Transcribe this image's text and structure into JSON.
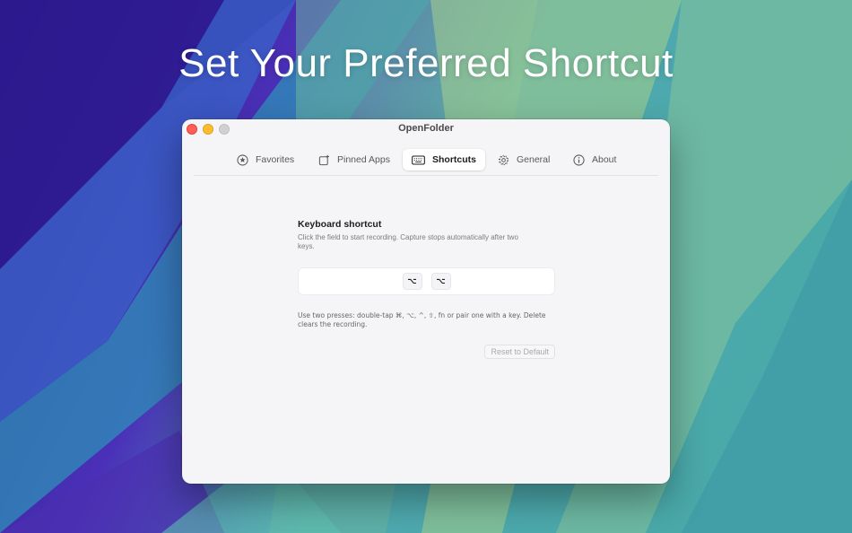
{
  "headline": "Set Your Preferred Shortcut",
  "window": {
    "title": "OpenFolder"
  },
  "tabs": [
    {
      "label": "Favorites",
      "icon": "star-circle-icon",
      "active": false
    },
    {
      "label": "Pinned Apps",
      "icon": "pin-app-icon",
      "active": false
    },
    {
      "label": "Shortcuts",
      "icon": "keyboard-icon",
      "active": true
    },
    {
      "label": "General",
      "icon": "gear-icon",
      "active": false
    },
    {
      "label": "About",
      "icon": "info-icon",
      "active": false
    }
  ],
  "shortcuts": {
    "title": "Keyboard shortcut",
    "description": "Click the field to start recording. Capture stops automatically after two keys.",
    "keys": [
      "⌥",
      "⌥"
    ],
    "hint": "Use two presses: double-tap ⌘, ⌥, ^, ⇧, fn or pair one with a key. Delete clears the recording.",
    "reset_label": "Reset to Default"
  },
  "colors": {
    "wallpaper_purple": "#3a22a0",
    "wallpaper_teal": "#3f9fb0",
    "wallpaper_green": "#9ec98c",
    "window_bg": "#f5f5f7"
  }
}
